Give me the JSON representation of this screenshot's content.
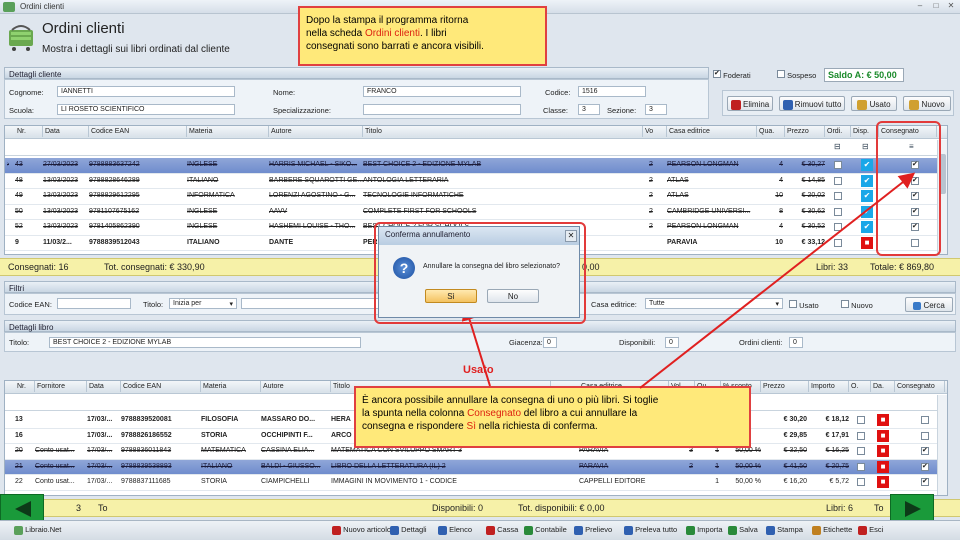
{
  "window": {
    "title": "Ordini clienti"
  },
  "header": {
    "title": "Ordini clienti",
    "subtitle": "Mostra i dettagli sui libri ordinati dal cliente"
  },
  "callout_top": {
    "line1": "Dopo la stampa il programma ritorna",
    "line2a": "nella scheda ",
    "line2b": "Ordini clienti",
    "line2c": ". I libri",
    "line3": "consegnati sono barrati e ancora visibili."
  },
  "callout_bottom": {
    "l1": "È ancora possibile annullare la consegna di uno o più libri. Si toglie",
    "l2a": "la spunta nella colonna ",
    "l2b": "Consegnato",
    "l2c": " del libro a cui annullare la",
    "l3a": "consegna e rispondere ",
    "l3b": "Sì",
    "l3c": " nella richiesta di conferma."
  },
  "client": {
    "section": "Dettagli cliente",
    "cognome_label": "Cognome:",
    "cognome": "IANNETTI",
    "nome_label": "Nome:",
    "nome": "FRANCO",
    "codice_label": "Codice:",
    "codice": "1516",
    "scuola_label": "Scuola:",
    "scuola": "LI ROSETO SCIENTIFICO",
    "specializzazione_label": "Specializzazione:",
    "classe_label": "Classe:",
    "classe": "3",
    "sezione_label": "Sezione:",
    "sezione": "3",
    "foderati_label": "Foderati",
    "sospeso_label": "Sospeso",
    "saldo": "Saldo A: € 50,00"
  },
  "actions": {
    "elimina": "Elimina",
    "rimuovi": "Rimuovi tutto",
    "usato": "Usato",
    "nuovo": "Nuovo"
  },
  "orders": {
    "columns": [
      "Nr.",
      "Data",
      "Codice EAN",
      "Materia",
      "Autore",
      "Titolo",
      "Vo",
      "Casa editrice",
      "Qua.",
      "Prezzo",
      "Ordi.",
      "Disp.",
      "Consegnato"
    ],
    "rows": [
      [
        "43",
        "27/03/2023",
        "9788883637242",
        "INGLESE",
        "HARRIS MICHAEL - SIKO...",
        "BEST CHOICE 2 - EDIZIONE MYLAB",
        "2",
        "PEARSON LONGMAN",
        "4",
        "€ 30,27"
      ],
      [
        "48",
        "13/03/2023",
        "9788828646289",
        "ITALIANO",
        "BARBERE SQUAROTTI GE...",
        "ANTOLOGIA LETTERARIA",
        "2",
        "ATLAS",
        "4",
        "€ 14,85"
      ],
      [
        "49",
        "13/03/2023",
        "9788829612295",
        "INFORMATICA",
        "LORENZI AGOSTINO - G...",
        "TECNOLOGIE INFORMATICHE",
        "2",
        "ATLAS",
        "10",
        "€ 20,02"
      ],
      [
        "50",
        "13/03/2023",
        "9781107675162",
        "INGLESE",
        "AAVV",
        "COMPLETE FIRST FOR SCHOOLS",
        "2",
        "CAMBRIDGE UNIVERSI...",
        "8",
        "€ 30,62"
      ],
      [
        "52",
        "13/03/2023",
        "9781405862390",
        "INGLESE",
        "HASHEMI LOUISE - THO...",
        "BEST CHOICE 2 FOR SCHOOLS",
        "2",
        "PEARSON LONGMAN",
        "4",
        "€ 30,52"
      ],
      [
        "9",
        "11/03/2...",
        "9788839512043",
        "ITALIANO",
        "DANTE",
        "PER",
        "",
        "PARAVIA",
        "10",
        "€ 33,12"
      ]
    ]
  },
  "summary_top": {
    "consegnati": "Consegnati: 16",
    "tot_consegnati": "Tot. consegnati: € 330,90",
    "mid": "0,00",
    "libri": "Libri: 33",
    "totale": "Totale: € 869,80"
  },
  "filtri": {
    "section": "Filtri",
    "codice_ean_label": "Codice EAN:",
    "titolo_label": "Titolo:",
    "titolo_mode": "Inizia per",
    "casa_label": "Casa editrice:",
    "casa": "Tutte",
    "usato_label": "Usato",
    "nuovo_label": "Nuovo",
    "cerca": "Cerca"
  },
  "libro": {
    "section": "Dettagli libro",
    "titolo_label": "Titolo:",
    "titolo": "BEST CHOICE 2 - EDIZIONE MYLAB",
    "giacenza_label": "Giacenza:",
    "giacenza": "0",
    "disponibili_label": "Disponibili:",
    "disponibili": "0",
    "ordini_label": "Ordini clienti:",
    "ordini": "0"
  },
  "usato_label": "Usato",
  "usato_table": {
    "columns": [
      "Nr.",
      "Fornitore",
      "Data",
      "Codice EAN",
      "Materia",
      "Autore",
      "Titolo",
      "Casa editrice",
      "Vol.",
      "Qu.",
      "% sconto",
      "Prezzo",
      "Importo",
      "O.",
      "Da.",
      "Consegnato"
    ],
    "rows": [
      [
        "13",
        "",
        "17/03/...",
        "9788839520081",
        "FILOSOFIA",
        "MASSARO DO...",
        "HERA",
        "",
        "",
        "",
        "",
        "€ 30,20",
        "€ 18,12"
      ],
      [
        "16",
        "",
        "17/03/...",
        "9788826186552",
        "STORIA",
        "OCCHIPINTI F...",
        "ARCO",
        "",
        "",
        "",
        "",
        "€ 29,85",
        "€ 17,91"
      ],
      [
        "20",
        "Conto usat...",
        "17/03/...",
        "9788836011843",
        "MATEMATICA",
        "CASSINA ELIA...",
        "MATEMATICA CON SVILUPPO SMART 3",
        "PARAVIA",
        "3",
        "1",
        "50,00 %",
        "€ 32,50",
        "€ 16,25"
      ],
      [
        "21",
        "Conto usat...",
        "17/03/...",
        "9788839538893",
        "ITALIANO",
        "BALDI - GIUSSO...",
        "LIBRO DELLA LETTERATURA (IL) 2",
        "PARAVIA",
        "2",
        "1",
        "50,00 %",
        "€ 41,50",
        "€ 20,75"
      ],
      [
        "22",
        "Conto usat...",
        "17/03/...",
        "9788837111685",
        "STORIA",
        "CIAMPICHELLI",
        "IMMAGINI IN MOVIMENTO 1 - CODICE",
        "CAPPELLI EDITORE",
        "",
        "1",
        "50,00 %",
        "€ 16,20",
        "€ 5,72"
      ]
    ]
  },
  "dialog": {
    "title": "Conferma annullamento",
    "message": "Annullare la consegna del libro selezionato?",
    "yes": "Sì",
    "no": "No"
  },
  "summary_bottom": {
    "count": "3",
    "tot": "To",
    "disponibili": "Disponibili: 0",
    "tot_disp": "Tot. disponibili: € 0,00",
    "libri": "Libri: 6"
  },
  "bottombar": {
    "app": "Libraio.Net",
    "items": [
      "Nuovo articolo",
      "Dettagli",
      "Elenco",
      "Cassa",
      "Contabile",
      "Prelievo",
      "Preleva tutto",
      "Importa",
      "Salva",
      "Stampa",
      "Etichette",
      "Esci"
    ]
  },
  "colors": {
    "accent_red": "#e23a3a",
    "highlight": "#ffe97a",
    "nav_green": "#1a9a3a"
  }
}
